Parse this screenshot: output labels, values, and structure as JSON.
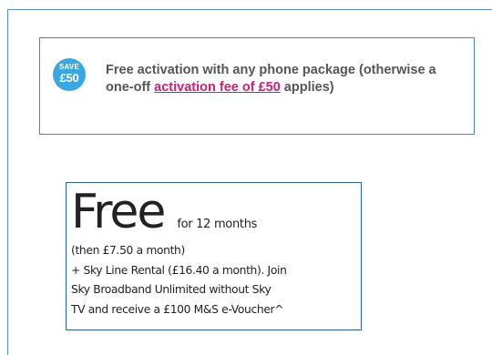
{
  "promo": {
    "badge_top": "SAVE",
    "badge_amount": "£50",
    "text_before_link": "Free activation with any phone package (otherwise a one-off ",
    "link_text": "activation fee of £50",
    "text_after_link": " applies)"
  },
  "offer": {
    "headline": "Free",
    "duration": "for 12 months",
    "details_lines": [
      "(then £7.50 a month)",
      "+ Sky Line Rental (£16.40 a month). Join",
      "Sky Broadband Unlimited without Sky",
      "TV and receive a £100 M&S e-Voucher^"
    ]
  },
  "colors": {
    "badge": "#3aa7e0",
    "link": "#c8217a",
    "box_border": "#3f86c2"
  }
}
